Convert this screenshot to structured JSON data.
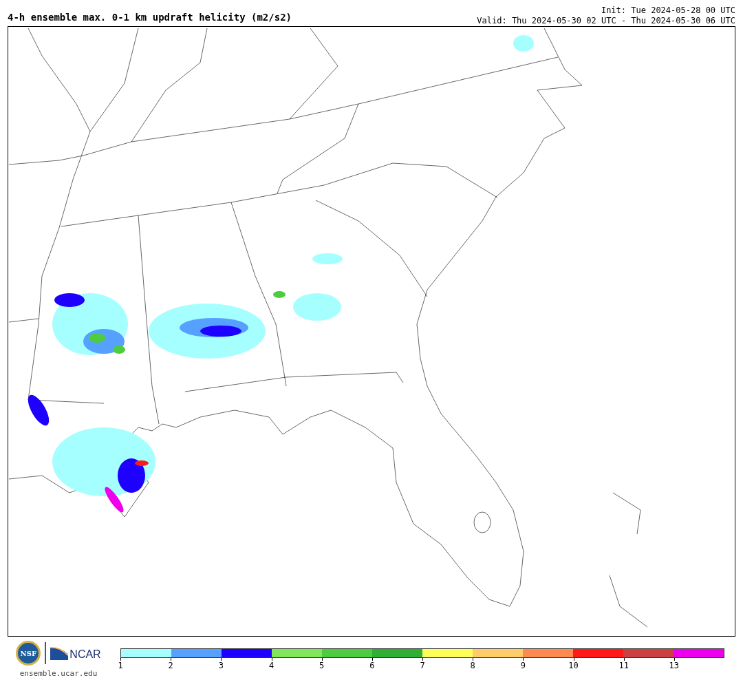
{
  "title": "4-h ensemble max. 0-1 km updraft helicity (m2/s2)",
  "init": "Init: Tue 2024-05-28 00 UTC",
  "valid": "Valid: Thu 2024-05-30 02 UTC - Thu 2024-05-30 06 UTC",
  "logos": [
    "NSF",
    "NCAR"
  ],
  "site": "ensemble.ucar.edu",
  "colorbar": {
    "bins": [
      {
        "color": "#a6ffff"
      },
      {
        "color": "#56a0ff"
      },
      {
        "color": "#1e00ff"
      },
      {
        "color": "#80e65a"
      },
      {
        "color": "#4dcc40"
      },
      {
        "color": "#2fb034"
      },
      {
        "color": "#ffff5a"
      },
      {
        "color": "#ffcc6a"
      },
      {
        "color": "#ff8a50"
      },
      {
        "color": "#ff1a1a"
      },
      {
        "color": "#cc4040"
      },
      {
        "color": "#ee00ee"
      }
    ],
    "ticks": [
      "1",
      "2",
      "3",
      "4",
      "5",
      "6",
      "7",
      "8",
      "9",
      "10",
      "11",
      "13"
    ]
  }
}
